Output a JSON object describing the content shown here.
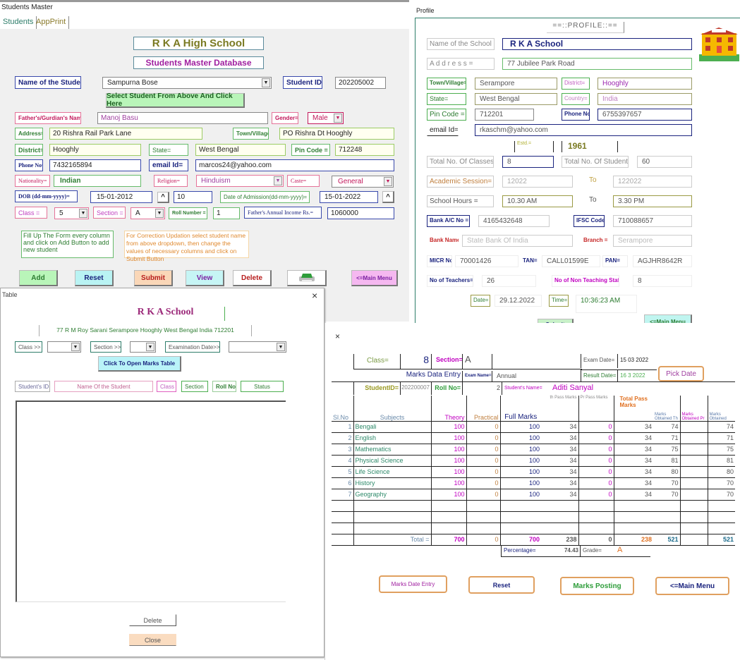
{
  "students_master": {
    "window_title": "Students Master",
    "tabs": [
      "Students",
      "AppPrint"
    ],
    "school_name": "R K A High School",
    "subtitle": "Students Master Database",
    "student_name_label": "Name of the Student=",
    "student_name_value": "Sampurna Bose",
    "student_id_label": "Student ID=",
    "student_id_value": "202205002",
    "select_button": "Select Student From Above And Click Here",
    "father_label": "Father's/Gurdian's Name=",
    "father_value": "Manoj Basu",
    "gender_label": "Gender=",
    "gender_value": "Male",
    "address_label": "Address=",
    "address_value": "20 Rishra Rail Park Lane",
    "town_label": "Town/Village=",
    "town_value": "PO Rishra Dt Hooghly",
    "district_label": "District=",
    "district_value": "Hooghly",
    "state_label": "State=",
    "state_value": "West Bengal",
    "pin_label": "Pin Code =",
    "pin_value": "712248",
    "phone_label": "Phone No=",
    "phone_value": "7432165894",
    "email_label": "email Id=",
    "email_value": "marcos24@yahoo.com",
    "nationality_label": "Nationality=",
    "nationality_value": "Indian",
    "religion_label": "Religion=",
    "religion_value": "Hinduism",
    "caste_label": "Caste=",
    "caste_value": "General",
    "dob_label": "DOB (dd-mm-yyyy)=",
    "dob_value": "15-01-2012",
    "age_value": "10",
    "caret": "^",
    "doa_label": "Date of Admission(dd-mm-yyyy)=",
    "doa_value": "15-01-2022",
    "class_label": "Class =",
    "class_value": "5",
    "section_label": "Section =",
    "section_value": "A",
    "roll_label": "Roll Number =",
    "roll_value": "1",
    "income_label": "Father's Annual Income Rs.=",
    "income_value": "1060000",
    "note_add": "Fill Up The Form every column and click on Add Button to add new student",
    "note_update": "For Correction Updation select student name from above dropdown, then change the values of necessary columns and click on Submit Button",
    "buttons": {
      "add": "Add",
      "reset": "Reset",
      "submit": "Submit",
      "view": "View",
      "delete": "Delete",
      "main_menu": "<=Main Menu"
    }
  },
  "profile": {
    "window_title": "Profile",
    "header": "==::PROFILE::==",
    "school_label": "Name of the School =",
    "school_value": "R K A School",
    "address_label": "A d d r e s s =",
    "address_value": "77 Jubilee Park Road",
    "town_label": "Town/Village=",
    "town_value": "Serampore",
    "district_label": "District=",
    "district_value": "Hooghly",
    "state_label": "State=",
    "state_value": "West Bengal",
    "country_label": "Country=",
    "country_value": "India",
    "pin_label": "Pin Code =",
    "pin_value": "712201",
    "phone_label": "Phone No=",
    "phone_value": "6755397657",
    "email_label": "email Id=",
    "email_value": "rkaschm@yahoo.com",
    "estd_label": "Estd.=",
    "estd_value": "1961",
    "classes_label": "Total No. Of Classes=",
    "classes_value": "8",
    "students_label": "Total No. Of Students=",
    "students_value": "60",
    "session_label": "Academic Session=",
    "session_from": "12022",
    "session_to": "122022",
    "to_label": "To",
    "hours_label": "School Hours =",
    "hours_from": "10.30 AM",
    "hours_to": "3.30 PM",
    "bank_ac_label": "Bank A/C No =",
    "bank_ac_value": "4165432648",
    "ifsc_label": "IFSC Code=",
    "ifsc_value": "710088657",
    "bank_name_label": "Bank Name =",
    "bank_name_value": "State Bank Of India",
    "branch_label": "Branch =",
    "branch_value": "Serampore",
    "micr_label": "MICR No=",
    "micr_value": "70001426",
    "tan_label": "TAN=",
    "tan_value": "CALL01599E",
    "pan_label": "PAN=",
    "pan_value": "AGJHR8642R",
    "teachers_label": "No of Teachers=",
    "teachers_value": "26",
    "nonteach_label": "No of Non Teaching Staff=",
    "nonteach_value": "8",
    "date_label": "Date=",
    "date_value": "29.12.2022",
    "time_label": "Time=",
    "time_value": "10:36:23 AM",
    "submit": "Submit",
    "main_menu": "<=Main Menu"
  },
  "table_window": {
    "window_title": "Table",
    "close": "×",
    "school_name": "R K A School",
    "address": "77 R M Roy Sarani Serampore Hooghly West Bengal India 712201",
    "class_label": "Class >>",
    "section_label": "Section >>",
    "exam_label": "Examination Date>>",
    "open_button": "Click To Open Marks Table",
    "columns": [
      "Student's ID",
      "Name Of the Student",
      "Class",
      "Section",
      "Roll No",
      "Status"
    ],
    "delete": "Delete",
    "close_button": "Close"
  },
  "marks": {
    "close": "×",
    "class_label": "Class=",
    "class_value": "8",
    "section_label": "Section=",
    "section_value": "A",
    "exam_date_label": "Exam Date=",
    "exam_date_value": "15 03 2022",
    "result_date_label": "Result Date=",
    "result_date_value": "16 3 2022",
    "pick_date": "Pick Date",
    "title": "Marks Data Entry",
    "exam_name_label": "Exam Name=",
    "exam_name_value": "Annual",
    "student_id_label": "StudentID=",
    "student_id_value": "202200007",
    "roll_label": "Roll No=",
    "roll_value": "2",
    "student_name_label": "Student's Name=",
    "student_name_value": "Aditi Sanyal",
    "headers": {
      "slno": "Sl.No",
      "subjects": "Subjects",
      "theory": "Theory",
      "practical": "Practical",
      "full": "Full Marks",
      "th_pass": "th Pass Marks",
      "pr_pass": "Pr Pass Marks",
      "total_pass": "Total Pass Marks",
      "obt_th": "Marks Obtained Th",
      "obt_pr": "Marks Obtained Pr",
      "obt": "Marks Obtained"
    },
    "rows": [
      {
        "no": "1",
        "subject": "Bengali",
        "theory": "100",
        "practical": "0",
        "full": "100",
        "th_pass": "34",
        "pr_pass": "0",
        "total_pass": "34",
        "obt_th": "74",
        "obt_pr": "",
        "obt": "74"
      },
      {
        "no": "2",
        "subject": "English",
        "theory": "100",
        "practical": "0",
        "full": "100",
        "th_pass": "34",
        "pr_pass": "0",
        "total_pass": "34",
        "obt_th": "71",
        "obt_pr": "",
        "obt": "71"
      },
      {
        "no": "3",
        "subject": "Mathematics",
        "theory": "100",
        "practical": "0",
        "full": "100",
        "th_pass": "34",
        "pr_pass": "0",
        "total_pass": "34",
        "obt_th": "75",
        "obt_pr": "",
        "obt": "75"
      },
      {
        "no": "4",
        "subject": "Physical Science",
        "theory": "100",
        "practical": "0",
        "full": "100",
        "th_pass": "34",
        "pr_pass": "0",
        "total_pass": "34",
        "obt_th": "81",
        "obt_pr": "",
        "obt": "81"
      },
      {
        "no": "5",
        "subject": "Life Science",
        "theory": "100",
        "practical": "0",
        "full": "100",
        "th_pass": "34",
        "pr_pass": "0",
        "total_pass": "34",
        "obt_th": "80",
        "obt_pr": "",
        "obt": "80"
      },
      {
        "no": "6",
        "subject": "History",
        "theory": "100",
        "practical": "0",
        "full": "100",
        "th_pass": "34",
        "pr_pass": "0",
        "total_pass": "34",
        "obt_th": "70",
        "obt_pr": "",
        "obt": "70"
      },
      {
        "no": "7",
        "subject": "Geography",
        "theory": "100",
        "practical": "0",
        "full": "100",
        "th_pass": "34",
        "pr_pass": "0",
        "total_pass": "34",
        "obt_th": "70",
        "obt_pr": "",
        "obt": "70"
      }
    ],
    "total_label": "Total =",
    "totals": {
      "theory": "700",
      "practical": "0",
      "full": "700",
      "th_pass": "238",
      "pr_pass": "0",
      "total_pass": "238",
      "obt_th": "521",
      "obt": "521"
    },
    "percentage_label": "Percentage=",
    "percentage_value": "74.43",
    "grade_label": "Grade=",
    "grade_value": "A",
    "buttons": {
      "entry": "Marks Date Entry",
      "reset": "Reset",
      "posting": "Marks Posting",
      "main_menu": "<=Main Menu"
    }
  }
}
